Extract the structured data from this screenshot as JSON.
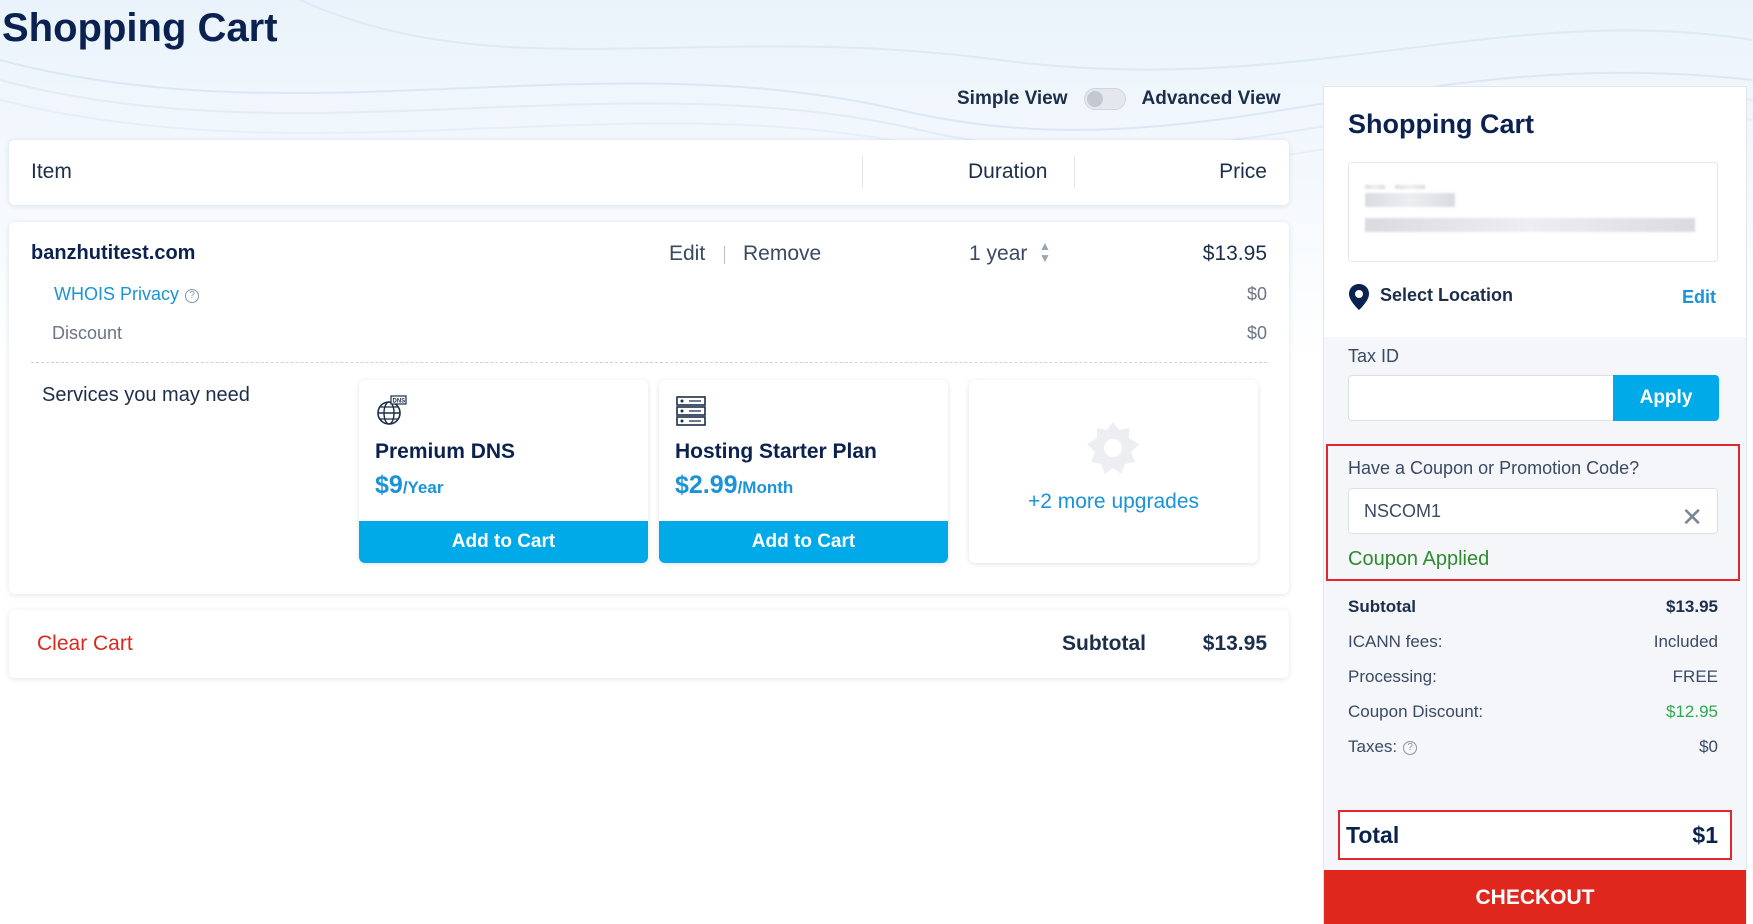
{
  "page": {
    "title": "Shopping Cart"
  },
  "view_toggle": {
    "left_label": "Simple View",
    "right_label": "Advanced View"
  },
  "table_header": {
    "item": "Item",
    "duration": "Duration",
    "price": "Price"
  },
  "cart_item": {
    "domain": "banzhutitest.com",
    "edit": "Edit",
    "remove": "Remove",
    "duration": "1 year",
    "price": "$13.95",
    "whois_label": "WHOIS Privacy",
    "whois_price": "$0",
    "discount_label": "Discount",
    "discount_price": "$0"
  },
  "services": {
    "label": "Services you may need",
    "items": [
      {
        "name": "Premium DNS",
        "price": "$9",
        "period": "/Year",
        "button": "Add to Cart",
        "icon": "dns-globe-icon"
      },
      {
        "name": "Hosting Starter Plan",
        "price": "$2.99",
        "period": "/Month",
        "button": "Add to Cart",
        "icon": "server-icon"
      }
    ],
    "more": "+2 more upgrades"
  },
  "footer": {
    "clear_cart": "Clear Cart",
    "subtotal_label": "Subtotal",
    "subtotal_value": "$13.95"
  },
  "sidebar": {
    "title": "Shopping Cart",
    "location_label": "Select Location",
    "location_edit": "Edit",
    "tax_label": "Tax ID",
    "tax_value": "",
    "apply": "Apply",
    "coupon_label": "Have a Coupon or Promotion Code?",
    "coupon_value": "NSCOM1",
    "coupon_status": "Coupon Applied",
    "summary": {
      "subtotal_label": "Subtotal",
      "subtotal_value": "$13.95",
      "icann_label": "ICANN fees:",
      "icann_value": "Included",
      "processing_label": "Processing:",
      "processing_value": "FREE",
      "coupon_label": "Coupon Discount:",
      "coupon_value": "$12.95",
      "taxes_label": "Taxes:",
      "taxes_value": "$0",
      "total_label": "Total",
      "total_value": "$1"
    },
    "checkout": "CHECKOUT"
  },
  "colors": {
    "brand_navy": "#0b2250",
    "accent_blue": "#00a9e8",
    "link_blue": "#1a93d8",
    "danger_red": "#e0271e",
    "success_green": "#2e8b2e"
  }
}
